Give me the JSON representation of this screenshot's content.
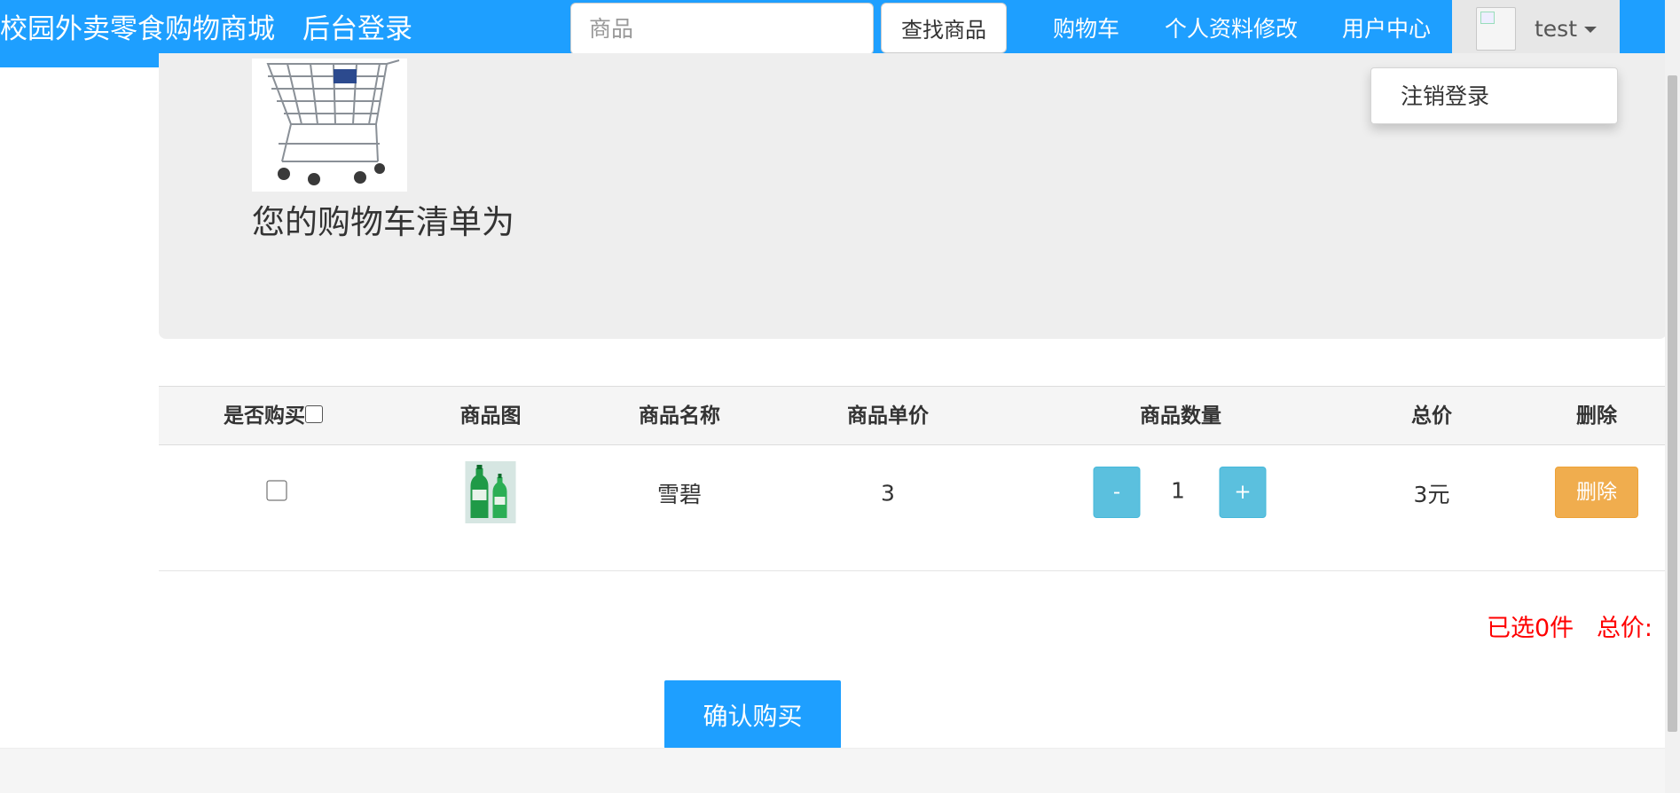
{
  "navbar": {
    "brand": "校园外卖零食购物商城",
    "admin_login": "后台登录",
    "search_placeholder": "商品",
    "search_button": "查找商品",
    "cart": "购物车",
    "profile_edit": "个人资料修改",
    "user_center": "用户中心",
    "username": "test",
    "dropdown_logout": "注销登录",
    "accent_color": "#1e9fff"
  },
  "jumbotron": {
    "title": "您的购物车清单为"
  },
  "table": {
    "headers": [
      "是否购买",
      "商品图",
      "商品名称",
      "商品单价",
      "商品数量",
      "总价",
      "删除"
    ],
    "rows": [
      {
        "name": "雪碧",
        "unit_price": "3",
        "quantity": "1",
        "minus": "-",
        "plus": "+",
        "total": "3元",
        "delete": "删除"
      }
    ]
  },
  "summary": {
    "selected": "已选0件",
    "total_label": "总价:"
  },
  "confirm_button": "确认购买"
}
